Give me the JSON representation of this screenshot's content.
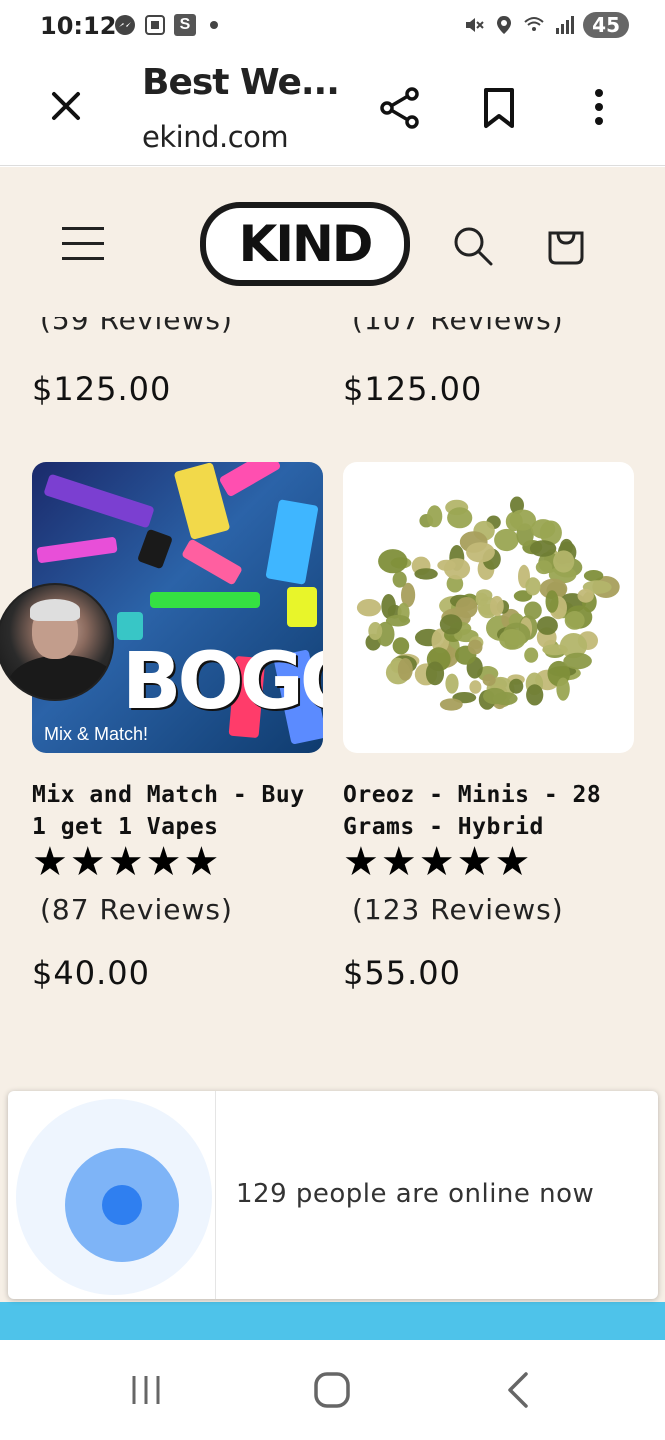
{
  "status_bar": {
    "time": "10:12",
    "battery": "45",
    "left_icons": [
      "messenger-icon",
      "screenshot-icon",
      "s-app-icon",
      "dot-icon"
    ],
    "right_icons": [
      "mute-icon",
      "location-icon",
      "wifi-icon",
      "signal-icon"
    ]
  },
  "browser": {
    "title": "Best We...",
    "url": "ekind.com",
    "actions": [
      "close-icon",
      "share-icon",
      "bookmark-icon",
      "more-icon"
    ]
  },
  "site": {
    "logo_text": "KIND",
    "background": "#f6efe6",
    "products_top": [
      {
        "reviews": "(59 Reviews)",
        "price": "$125.00"
      },
      {
        "reviews": "(107 Reviews)",
        "price": "$125.00"
      }
    ],
    "products": [
      {
        "name": "Mix and Match - Buy 1 get 1 Vapes",
        "image_label": "Mix & Match!",
        "image_banner": "BOGO",
        "stars": "★★★★★",
        "rating": 5,
        "reviews": "(87 Reviews)",
        "price": "$40.00"
      },
      {
        "name": "Oreoz - Minis - 28 Grams - Hybrid",
        "stars": "★★★★★",
        "rating": 5,
        "reviews": "(123 Reviews)",
        "price": "$55.00"
      }
    ]
  },
  "popup": {
    "text": "129 people are online now",
    "accent": "#2f7ff0"
  },
  "nav": {
    "icons": [
      "recents-icon",
      "home-icon",
      "back-icon"
    ]
  }
}
